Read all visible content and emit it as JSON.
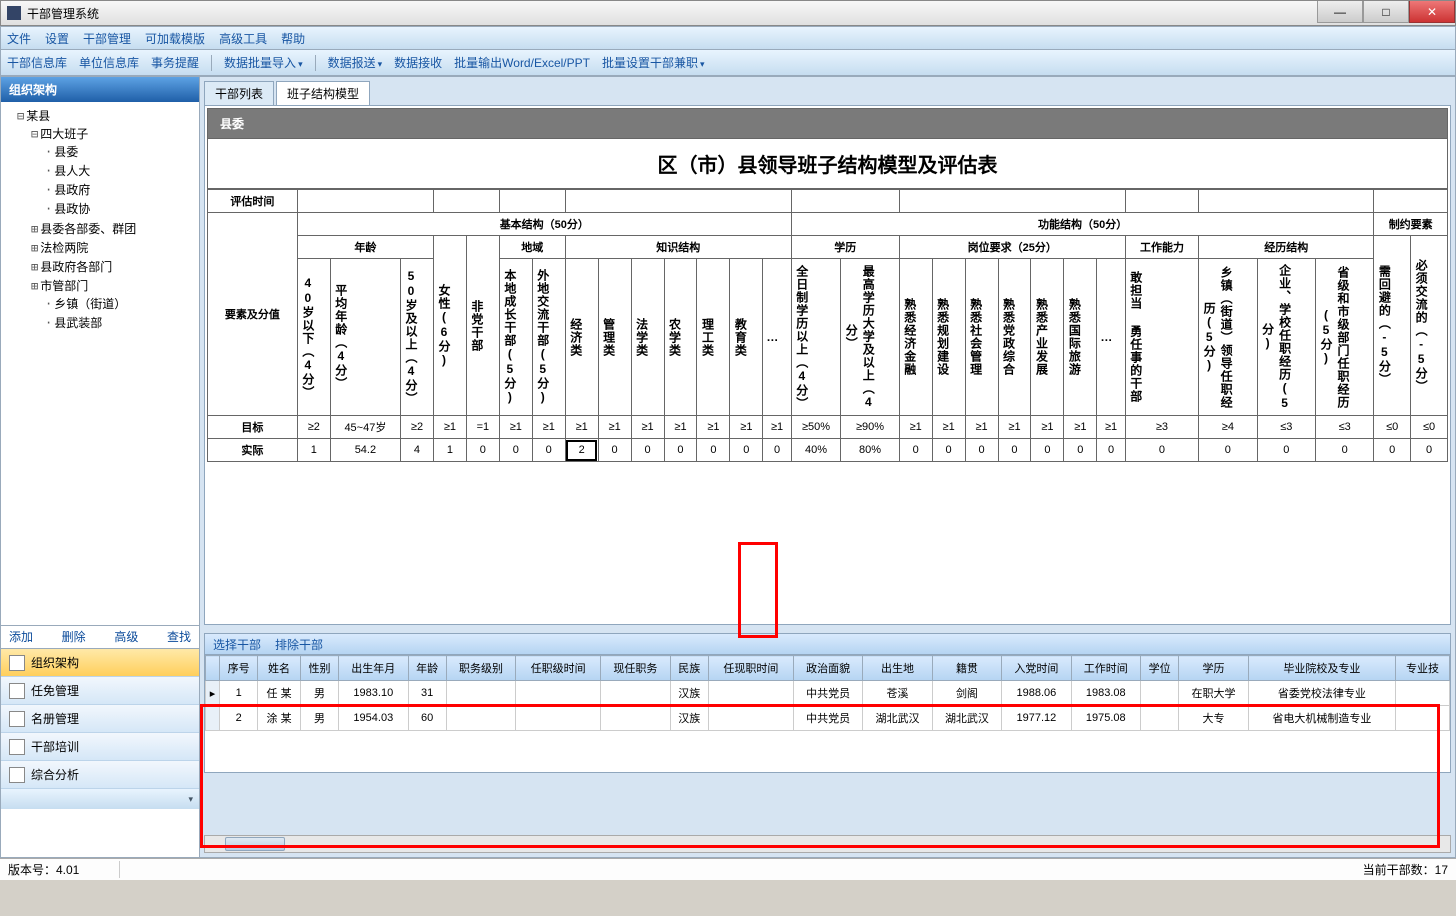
{
  "window": {
    "title": "干部管理系统"
  },
  "winbtns": {
    "min": "—",
    "max": "□",
    "close": "✕"
  },
  "menu": [
    "文件",
    "设置",
    "干部管理",
    "可加载模版",
    "高级工具",
    "帮助"
  ],
  "toolbar": [
    {
      "l": "干部信息库",
      "d": false
    },
    {
      "l": "单位信息库",
      "d": false
    },
    {
      "l": "事务提醒",
      "d": false
    },
    {
      "l": "|"
    },
    {
      "l": "数据批量导入",
      "d": true
    },
    {
      "l": "|"
    },
    {
      "l": "数据报送",
      "d": true
    },
    {
      "l": "数据接收",
      "d": false
    },
    {
      "l": "批量输出Word/Excel/PPT",
      "d": false
    },
    {
      "l": "批量设置干部兼职",
      "d": true
    }
  ],
  "sidebar": {
    "title": "组织架构",
    "actions": {
      "add": "添加",
      "del": "删除",
      "adv": "高级",
      "find": "查找"
    },
    "nav": [
      {
        "l": "组织架构",
        "a": true
      },
      {
        "l": "任免管理"
      },
      {
        "l": "名册管理"
      },
      {
        "l": "干部培训"
      },
      {
        "l": "综合分析"
      }
    ],
    "tree": {
      "root": "某县",
      "n1": "四大班子",
      "n1c": [
        "县委",
        "县人大",
        "县政府",
        "县政协"
      ],
      "n2": "县委各部委、群团",
      "n3": "法检两院",
      "n4": "县政府各部门",
      "n5": "市管部门",
      "n5c": [
        "乡镇（街道）",
        "县武装部"
      ]
    }
  },
  "tabs": {
    "a": "干部列表",
    "b": "班子结构模型"
  },
  "panel": {
    "header": "县委",
    "title": "区（市）县领导班子结构模型及评估表"
  },
  "et": {
    "evalTime": "评估时间",
    "sec1": "基本结构（50分）",
    "sec2": "功能结构（50分）",
    "sec3": "制约要素",
    "g_age": "年龄",
    "g_region": "地域",
    "g_know": "知识结构",
    "g_edu": "学历",
    "g_post": "岗位要求（25分）",
    "g_work": "工作能力",
    "g_exp": "经历结构",
    "rowhdr": "要素及分值",
    "cols": [
      "40岁以下（4分）",
      "平均年龄（4分）",
      "50岁及以上（4分）",
      "女性(6分)",
      "非党干部",
      "本地成长干部(5分)",
      "外地交流干部(5分)",
      "经济类",
      "管理类",
      "法学类",
      "农学类",
      "理工类",
      "教育类",
      "…",
      "全日制学历以上（4分）",
      "最高学历大学及以上（4分）",
      "熟悉经济金融",
      "熟悉规划建设",
      "熟悉社会管理",
      "熟悉党政综合",
      "熟悉产业发展",
      "熟悉国际旅游",
      "…",
      "敢担当 勇任事的干部",
      "乡镇（街道）领导任职经历(5分)",
      "企业、学校任职经历(5分)",
      "省级和市级部门任职经历(5分)",
      "需回避的（-5分）",
      "必须交流的（-5分）"
    ],
    "target_label": "目标",
    "actual_label": "实际",
    "target": [
      "≥2",
      "45~47岁",
      "≥2",
      "≥1",
      "=1",
      "≥1",
      "≥1",
      "≥1",
      "≥1",
      "≥1",
      "≥1",
      "≥1",
      "≥1",
      "≥1",
      "≥50%",
      "≥90%",
      "≥1",
      "≥1",
      "≥1",
      "≥1",
      "≥1",
      "≥1",
      "≥1",
      "≥3",
      "≥4",
      "≤3",
      "≤3",
      "≤0",
      "≤0"
    ],
    "actual": [
      "1",
      "54.2",
      "4",
      "1",
      "0",
      "0",
      "0",
      "2",
      "0",
      "0",
      "0",
      "0",
      "0",
      "0",
      "40%",
      "80%",
      "0",
      "0",
      "0",
      "0",
      "0",
      "0",
      "0",
      "0",
      "0",
      "0",
      "0",
      "0",
      "0"
    ]
  },
  "lower": {
    "bar": {
      "a": "选择干部",
      "b": "排除干部"
    },
    "cols": [
      "序号",
      "姓名",
      "性别",
      "出生年月",
      "年龄",
      "职务级别",
      "任职级时间",
      "现任职务",
      "民族",
      "任现职时间",
      "政治面貌",
      "出生地",
      "籍贯",
      "入党时间",
      "工作时间",
      "学位",
      "学历",
      "毕业院校及专业",
      "专业技"
    ],
    "rows": [
      {
        "c": [
          "1",
          "任 某",
          "男",
          "1983.10",
          "31",
          "",
          "",
          "",
          "汉族",
          "",
          "中共党员",
          "苍溪",
          "剑阁",
          "1988.06",
          "1983.08",
          "",
          "在职大学",
          "省委党校法律专业",
          ""
        ]
      },
      {
        "c": [
          "2",
          "涂 某",
          "男",
          "1954.03",
          "60",
          "",
          "",
          "",
          "汉族",
          "",
          "中共党员",
          "湖北武汉",
          "湖北武汉",
          "1977.12",
          "1975.08",
          "",
          "大专",
          "省电大机械制造专业",
          ""
        ]
      }
    ]
  },
  "status": {
    "ver": "版本号：4.01",
    "count": "当前干部数：17"
  }
}
